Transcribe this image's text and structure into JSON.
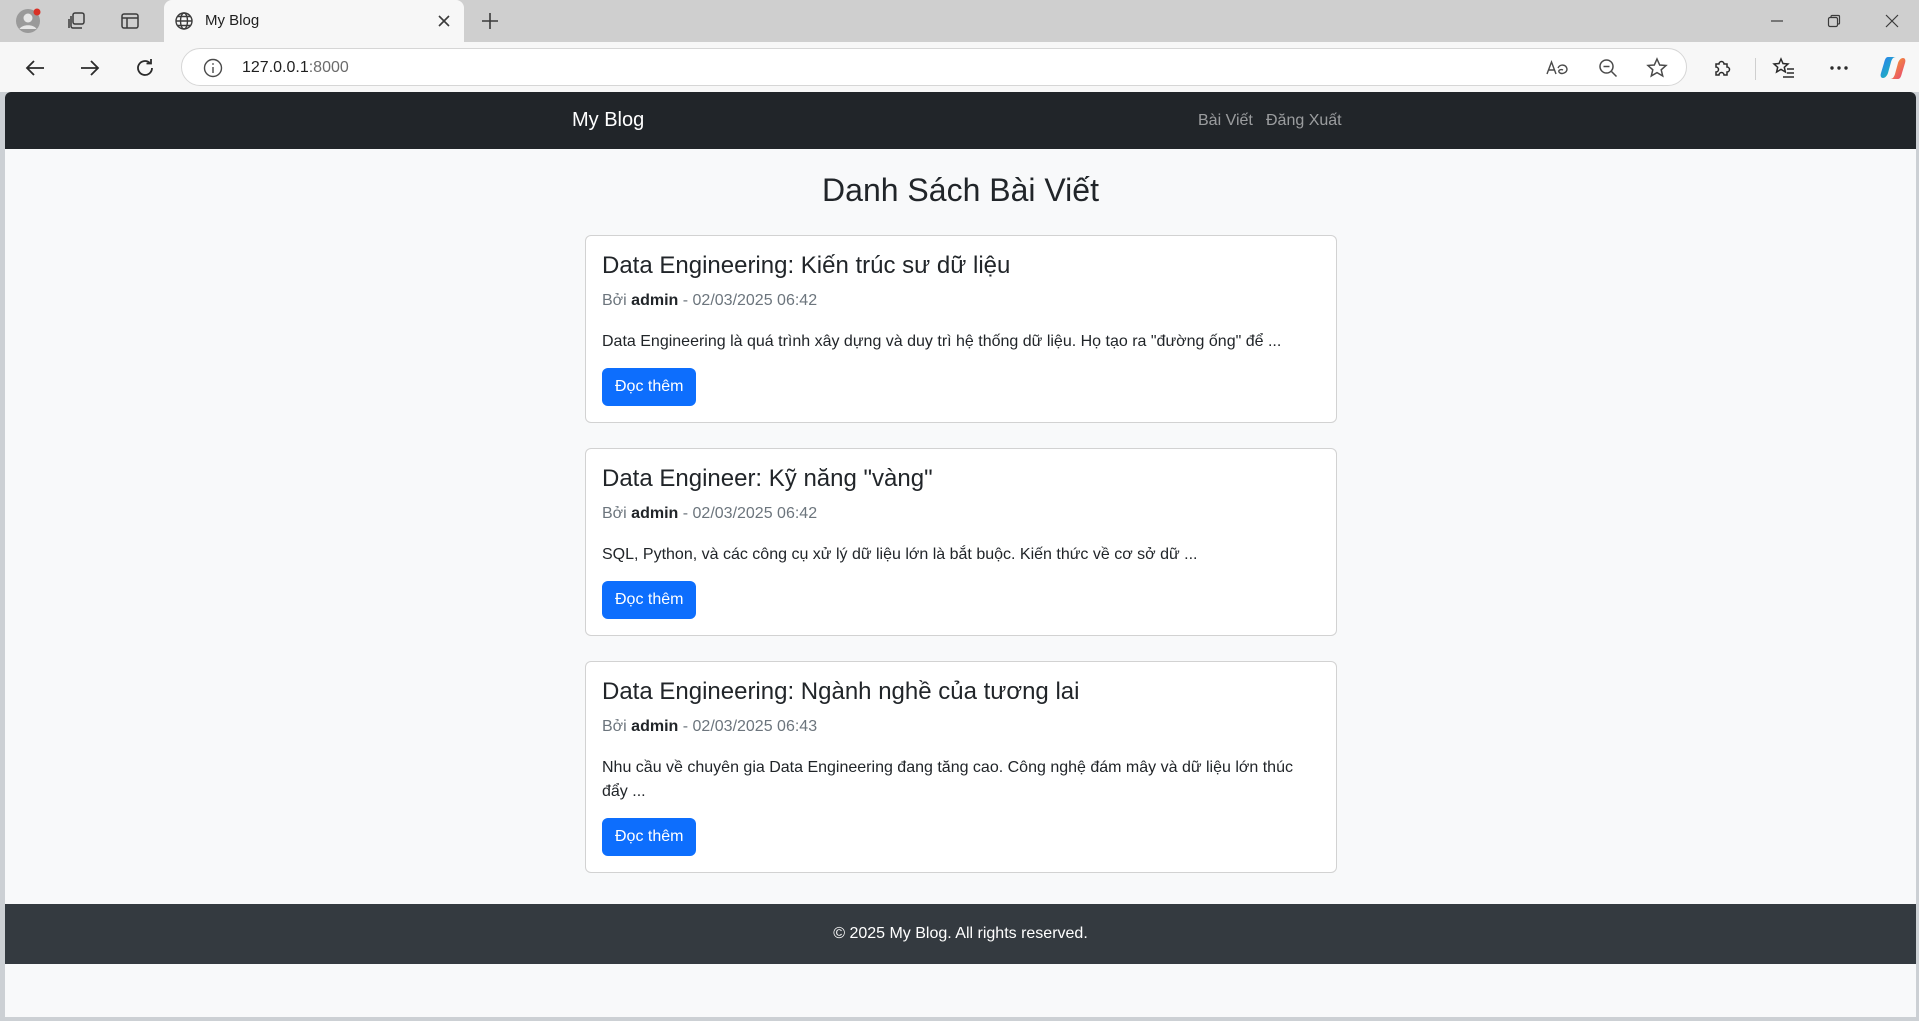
{
  "browser": {
    "tab_title": "My Blog",
    "url_host": "127.0.0.1",
    "url_port": ":8000"
  },
  "site": {
    "brand": "My Blog",
    "nav": [
      {
        "label": "Bài Viết"
      },
      {
        "label": "Đăng Xuất"
      }
    ],
    "heading": "Danh Sách Bài Viết",
    "posts": [
      {
        "title": "Data Engineering: Kiến trúc sư dữ liệu",
        "by_label": "Bởi",
        "author": "admin",
        "date": "- 02/03/2025 06:42",
        "excerpt": "Data Engineering là quá trình xây dựng và duy trì hệ thống dữ liệu. Họ tạo ra \"đường ống\" để ...",
        "button": "Đọc thêm"
      },
      {
        "title": "Data Engineer: Kỹ năng \"vàng\"",
        "by_label": "Bởi",
        "author": "admin",
        "date": "- 02/03/2025 06:42",
        "excerpt": "SQL, Python, và các công cụ xử lý dữ liệu lớn là bắt buộc. Kiến thức về cơ sở dữ ...",
        "button": "Đọc thêm"
      },
      {
        "title": "Data Engineering: Ngành nghề của tương lai",
        "by_label": "Bởi",
        "author": "admin",
        "date": "- 02/03/2025 06:43",
        "excerpt": "Nhu cầu về chuyên gia Data Engineering đang tăng cao. Công nghệ đám mây và dữ liệu lớn thúc đẩy ...",
        "button": "Đọc thêm"
      }
    ],
    "footer": "© 2025 My Blog. All rights reserved."
  },
  "colors": {
    "navbar": "#212529",
    "primary_button": "#0d6efd",
    "footer": "#343a40",
    "page_background": "#f8f9fa"
  }
}
